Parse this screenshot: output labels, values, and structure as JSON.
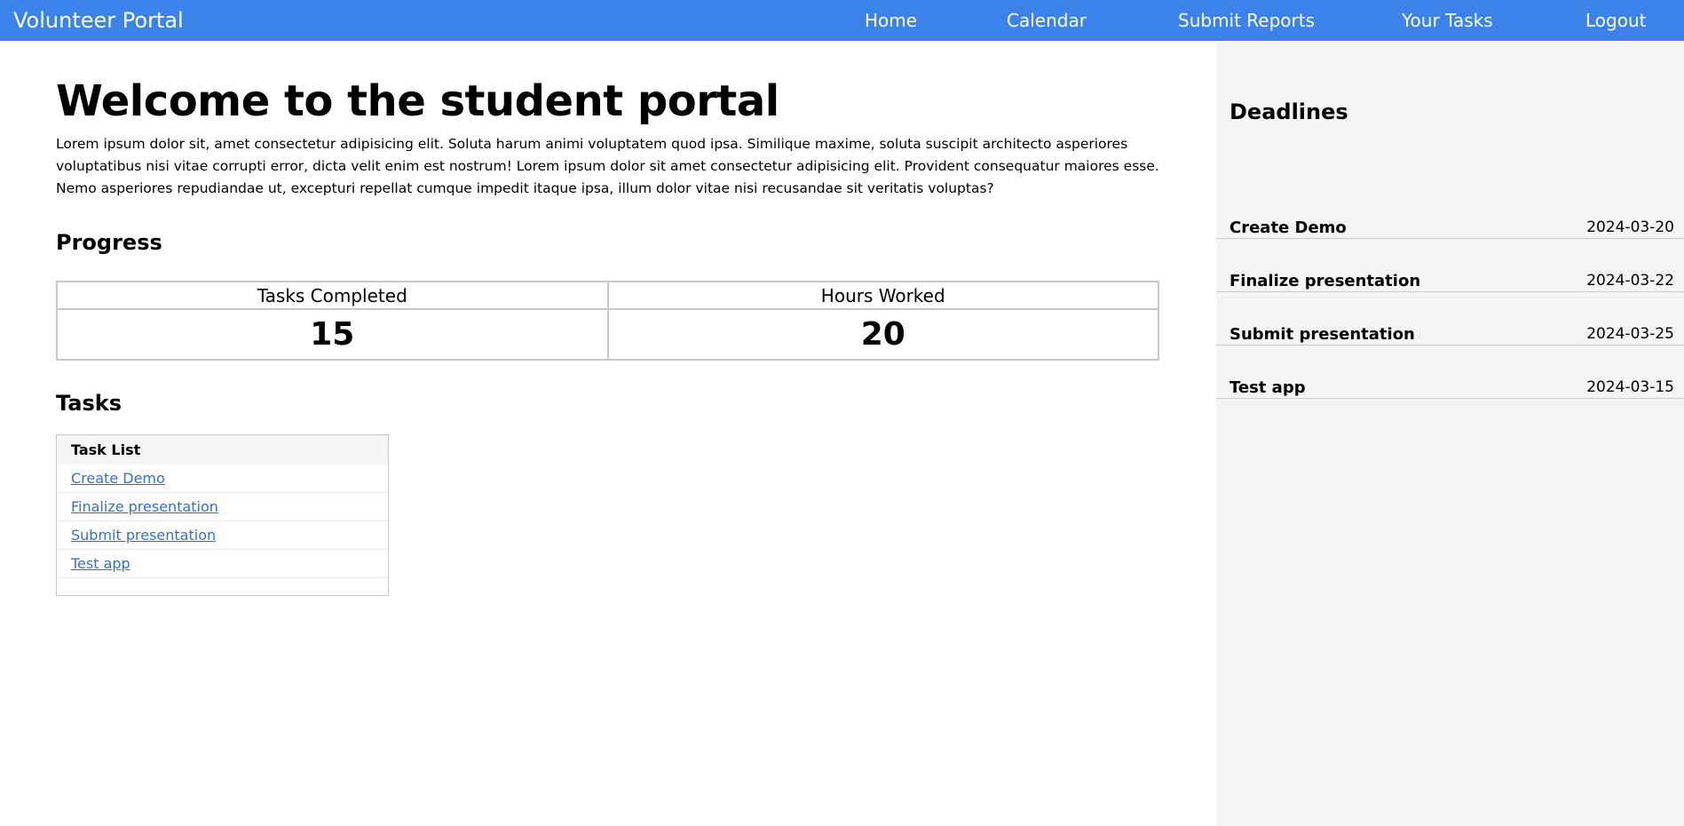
{
  "navbar": {
    "brand": "Volunteer Portal",
    "links": [
      "Home",
      "Calendar",
      "Submit Reports",
      "Your Tasks",
      "Logout"
    ]
  },
  "main": {
    "title": "Welcome to the student portal",
    "intro": "Lorem ipsum dolor sit, amet consectetur adipisicing elit. Soluta harum animi voluptatem quod ipsa. Similique maxime, soluta suscipit architecto asperiores voluptatibus nisi vitae corrupti error, dicta velit enim est nostrum! Lorem ipsum dolor sit amet consectetur adipisicing elit. Provident consequatur maiores esse. Nemo asperiores repudiandae ut, excepturi repellat cumque impedit itaque ipsa, illum dolor vitae nisi recusandae sit veritatis voluptas?",
    "progress": {
      "heading": "Progress",
      "stats": [
        {
          "label": "Tasks Completed",
          "value": "15"
        },
        {
          "label": "Hours Worked",
          "value": "20"
        }
      ]
    },
    "tasks": {
      "heading": "Tasks",
      "list_header": "Task List",
      "items": [
        "Create Demo",
        "Finalize presentation",
        "Submit presentation",
        "Test app"
      ]
    }
  },
  "sidebar": {
    "title": "Deadlines",
    "deadlines": [
      {
        "name": "Create Demo",
        "date": "2024-03-20"
      },
      {
        "name": "Finalize presentation",
        "date": "2024-03-22"
      },
      {
        "name": "Submit presentation",
        "date": "2024-03-25"
      },
      {
        "name": "Test app",
        "date": "2024-03-15"
      }
    ]
  },
  "colors": {
    "navbar_bg": "#3b82ea",
    "sidebar_bg": "#f4f4f4",
    "link": "#2f6fd6"
  }
}
